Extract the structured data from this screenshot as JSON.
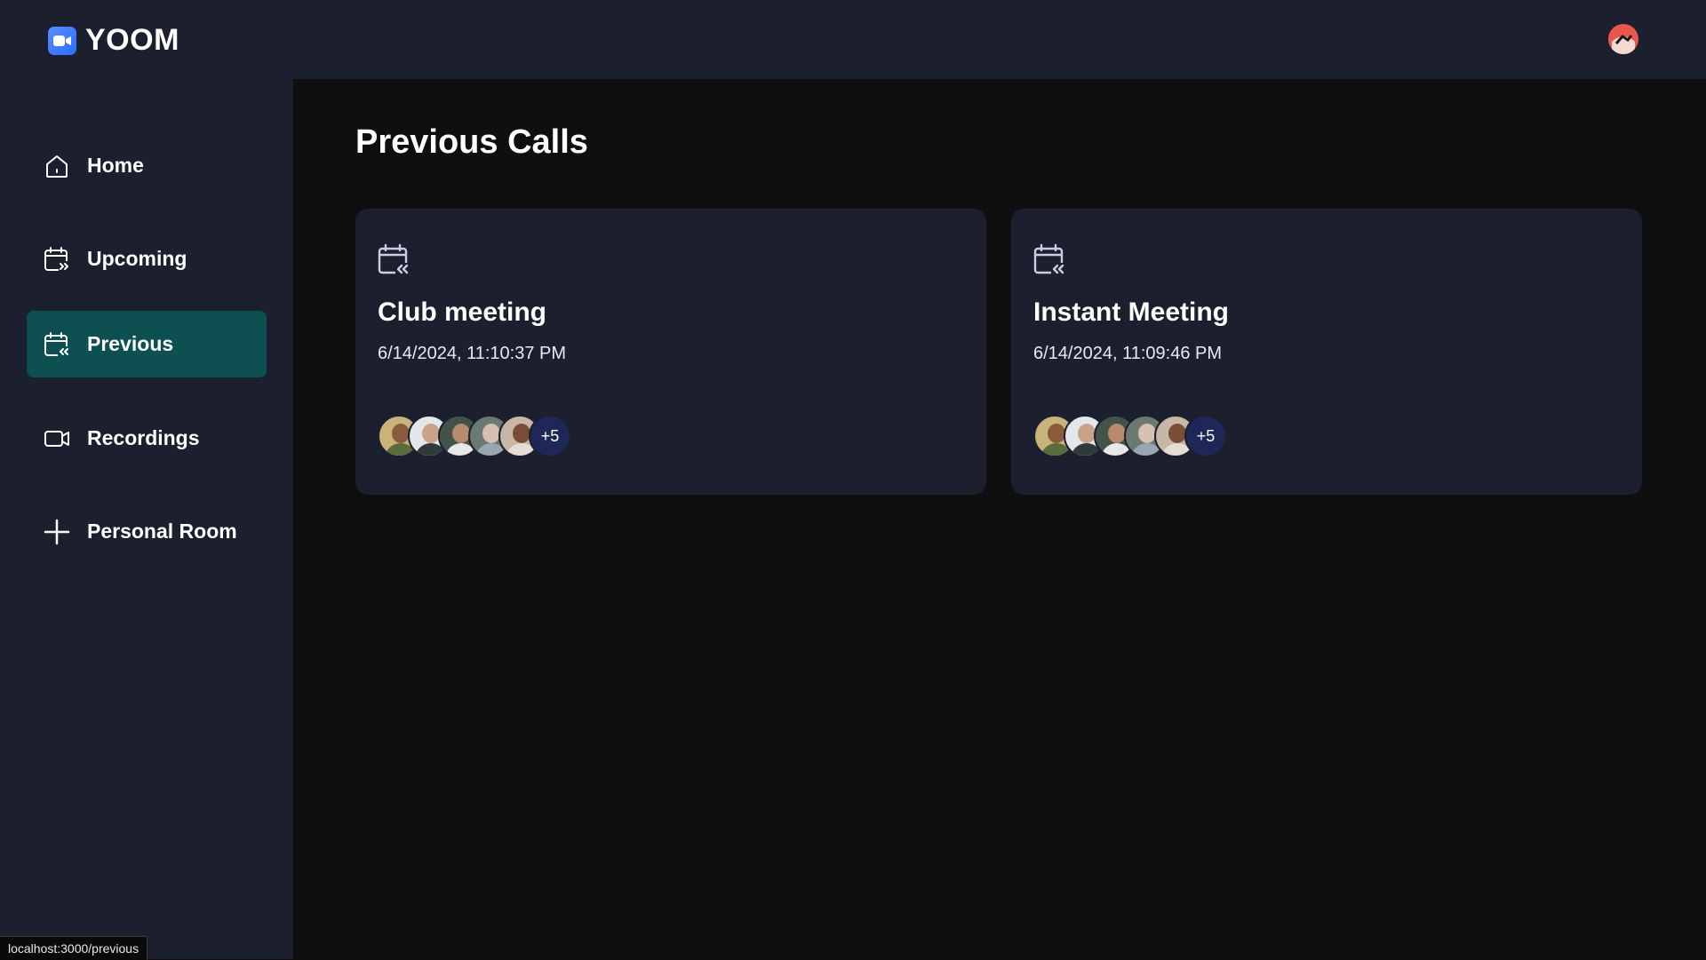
{
  "app": {
    "name": "YOOM",
    "brand_color": "#2d6cff"
  },
  "sidebar": {
    "items": [
      {
        "label": "Home",
        "icon": "home-icon",
        "active": false
      },
      {
        "label": "Upcoming",
        "icon": "calendar-forward-icon",
        "active": false
      },
      {
        "label": "Previous",
        "icon": "calendar-back-icon",
        "active": true
      },
      {
        "label": "Recordings",
        "icon": "video-icon",
        "active": false
      },
      {
        "label": "Personal Room",
        "icon": "plus-icon",
        "active": false
      }
    ],
    "active_color": "#0e5052"
  },
  "main": {
    "title": "Previous Calls",
    "cards": [
      {
        "icon": "calendar-back-icon",
        "title": "Club meeting",
        "date": "6/14/2024, 11:10:37 PM",
        "extra_attendees": "+5"
      },
      {
        "icon": "calendar-back-icon",
        "title": "Instant Meeting",
        "date": "6/14/2024, 11:09:46 PM",
        "extra_attendees": "+5"
      }
    ]
  },
  "status_bar": {
    "url": "localhost:3000/previous"
  }
}
